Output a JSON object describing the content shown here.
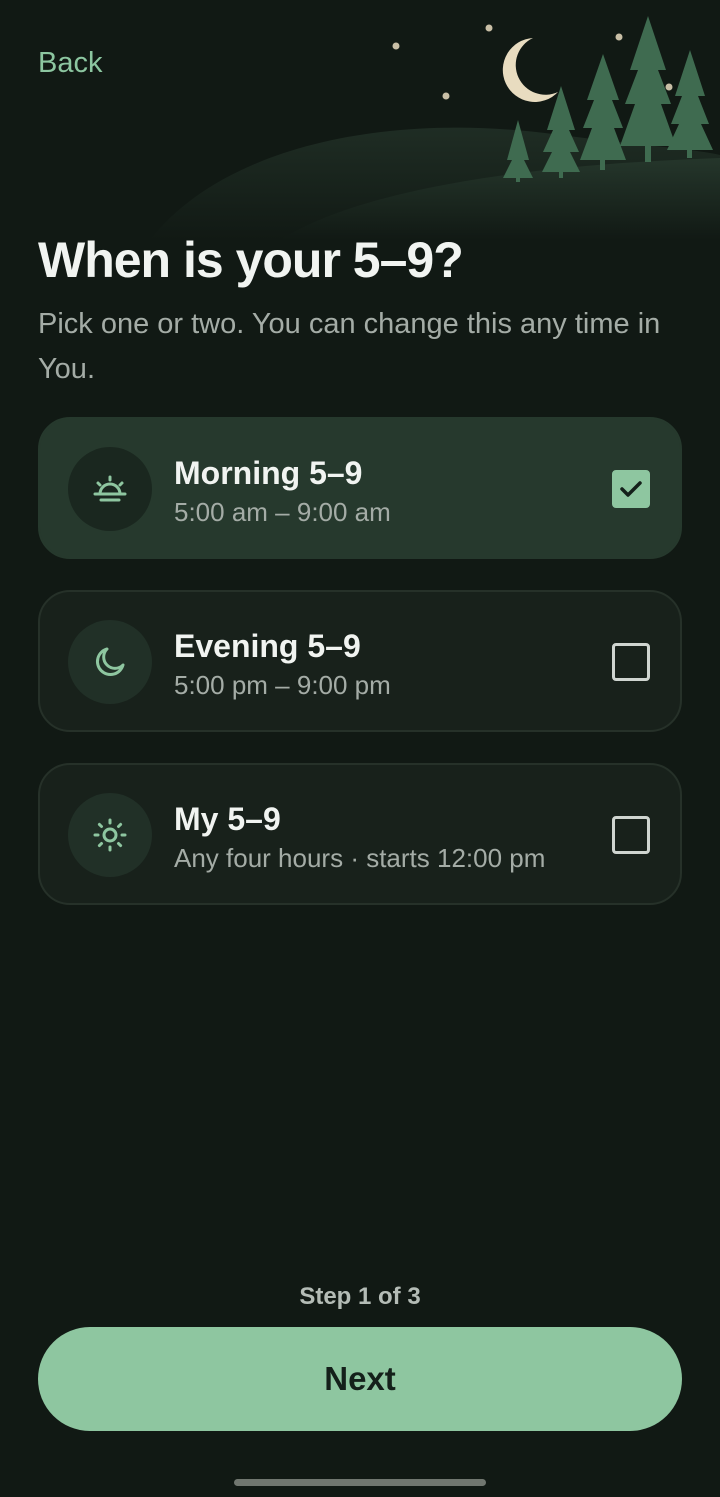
{
  "header": {
    "back_label": "Back"
  },
  "page": {
    "title": "When is your 5–9?",
    "subtitle": "Pick one or two. You can change this any time in You."
  },
  "options": [
    {
      "title": "Morning 5–9",
      "time": "5:00 am – 9:00 am",
      "icon": "sunrise-icon",
      "selected": true
    },
    {
      "title": "Evening 5–9",
      "time": "5:00 pm – 9:00 pm",
      "icon": "moon-icon",
      "selected": false
    },
    {
      "title": "My 5–9",
      "time": "Any four hours · starts 12:00 pm",
      "icon": "sun-icon",
      "selected": false
    }
  ],
  "footer": {
    "step_label": "Step 1 of 3",
    "next_label": "Next"
  },
  "colors": {
    "background": "#111914",
    "accent": "#8ec6a0",
    "card": "#18211b",
    "card_selected": "#26392d",
    "moon": "#e8dcc0"
  }
}
